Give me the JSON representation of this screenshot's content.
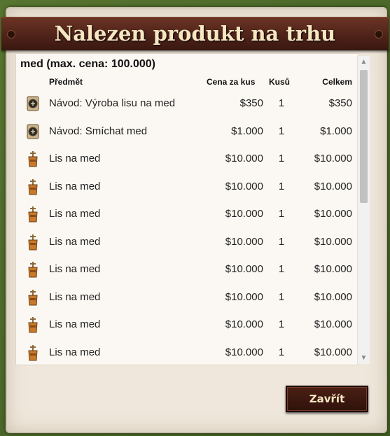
{
  "dialog": {
    "title": "Nalezen produkt na trhu",
    "heading": "med (max. cena: 100.000)",
    "close_label": "Zavřít"
  },
  "columns": {
    "item": "Předmět",
    "unit_price": "Cena za kus",
    "qty": "Kusů",
    "total": "Celkem"
  },
  "rows": [
    {
      "icon": "recipe-scroll-icon",
      "name": "Návod: Výroba lisu na med",
      "price": "$350",
      "qty": "1",
      "total": "$350"
    },
    {
      "icon": "recipe-scroll-icon",
      "name": "Návod: Smíchat med",
      "price": "$1.000",
      "qty": "1",
      "total": "$1.000"
    },
    {
      "icon": "honey-press-icon",
      "name": "Lis na med",
      "price": "$10.000",
      "qty": "1",
      "total": "$10.000"
    },
    {
      "icon": "honey-press-icon",
      "name": "Lis na med",
      "price": "$10.000",
      "qty": "1",
      "total": "$10.000"
    },
    {
      "icon": "honey-press-icon",
      "name": "Lis na med",
      "price": "$10.000",
      "qty": "1",
      "total": "$10.000"
    },
    {
      "icon": "honey-press-icon",
      "name": "Lis na med",
      "price": "$10.000",
      "qty": "1",
      "total": "$10.000"
    },
    {
      "icon": "honey-press-icon",
      "name": "Lis na med",
      "price": "$10.000",
      "qty": "1",
      "total": "$10.000"
    },
    {
      "icon": "honey-press-icon",
      "name": "Lis na med",
      "price": "$10.000",
      "qty": "1",
      "total": "$10.000"
    },
    {
      "icon": "honey-press-icon",
      "name": "Lis na med",
      "price": "$10.000",
      "qty": "1",
      "total": "$10.000"
    },
    {
      "icon": "honey-press-icon",
      "name": "Lis na med",
      "price": "$10.000",
      "qty": "1",
      "total": "$10.000"
    }
  ],
  "colors": {
    "title_bar": "#4d2218",
    "title_text": "#f6e6c2",
    "parchment": "#efe7db"
  }
}
